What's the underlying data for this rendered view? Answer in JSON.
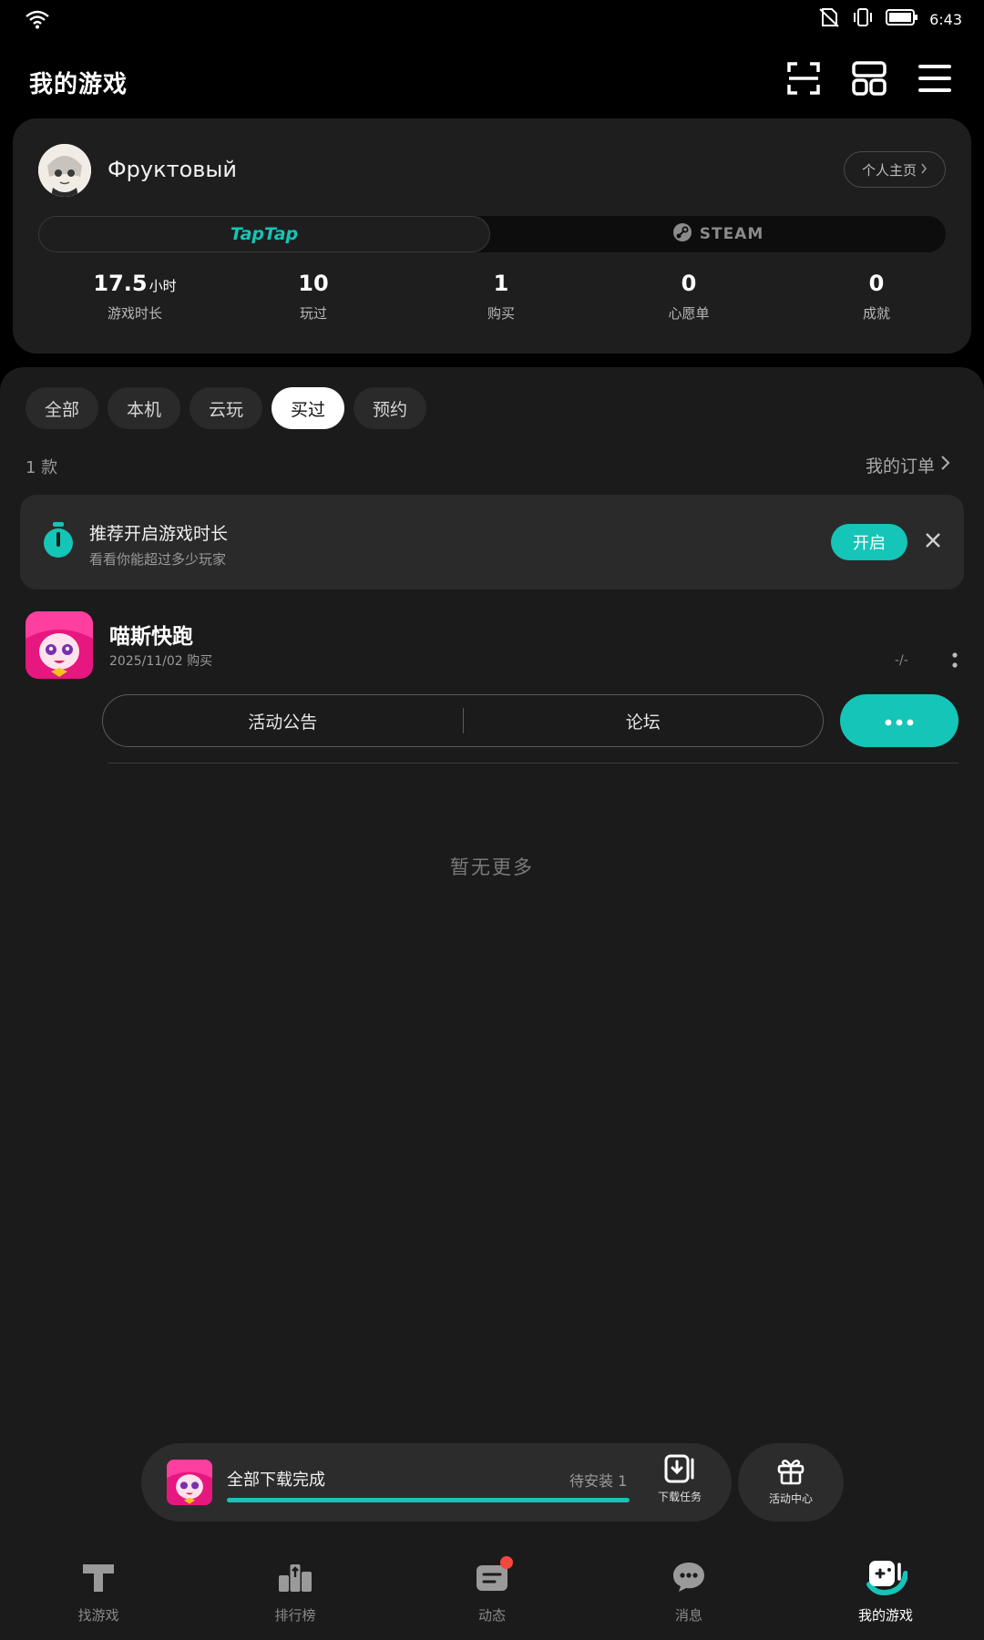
{
  "status_bar": {
    "time": "6:43"
  },
  "header": {
    "title": "我的游戏"
  },
  "profile": {
    "username": "Фруктовый",
    "home_button": "个人主页",
    "platforms": {
      "taptap": "TapTap",
      "steam": "STEAM"
    },
    "stats": [
      {
        "value": "17.5",
        "unit": "小时",
        "label": "游戏时长"
      },
      {
        "value": "10",
        "unit": "",
        "label": "玩过"
      },
      {
        "value": "1",
        "unit": "",
        "label": "购买"
      },
      {
        "value": "0",
        "unit": "",
        "label": "心愿单"
      },
      {
        "value": "0",
        "unit": "",
        "label": "成就"
      }
    ]
  },
  "filters": {
    "tabs": [
      "全部",
      "本机",
      "云玩",
      "买过",
      "预约"
    ],
    "active": "买过"
  },
  "list": {
    "count": "1 款",
    "orders_link": "我的订单"
  },
  "banner": {
    "title": "推荐开启游戏时长",
    "subtitle": "看看你能超过多少玩家",
    "button": "开启"
  },
  "game": {
    "name": "喵斯快跑",
    "purchase_info": "2025/11/02 购买",
    "size": "-/-",
    "buttons": {
      "announcement": "活动公告",
      "forum": "论坛"
    }
  },
  "no_more": "暂无更多",
  "download": {
    "status": "全部下载完成",
    "pending": "待安装 1",
    "progress": 1.0,
    "task_label": "下载任务"
  },
  "activity": {
    "label": "活动中心"
  },
  "bottom_nav": [
    {
      "label": "找游戏",
      "icon": "taptap-logo-icon"
    },
    {
      "label": "排行榜",
      "icon": "ranking-icon"
    },
    {
      "label": "动态",
      "icon": "feed-icon"
    },
    {
      "label": "消息",
      "icon": "message-icon"
    },
    {
      "label": "我的游戏",
      "icon": "gamepad-icon"
    }
  ],
  "colors": {
    "accent": "#15c5b7",
    "background": "#1b1b1b",
    "card": "#1e1e1e",
    "badge": "#f4473f"
  }
}
